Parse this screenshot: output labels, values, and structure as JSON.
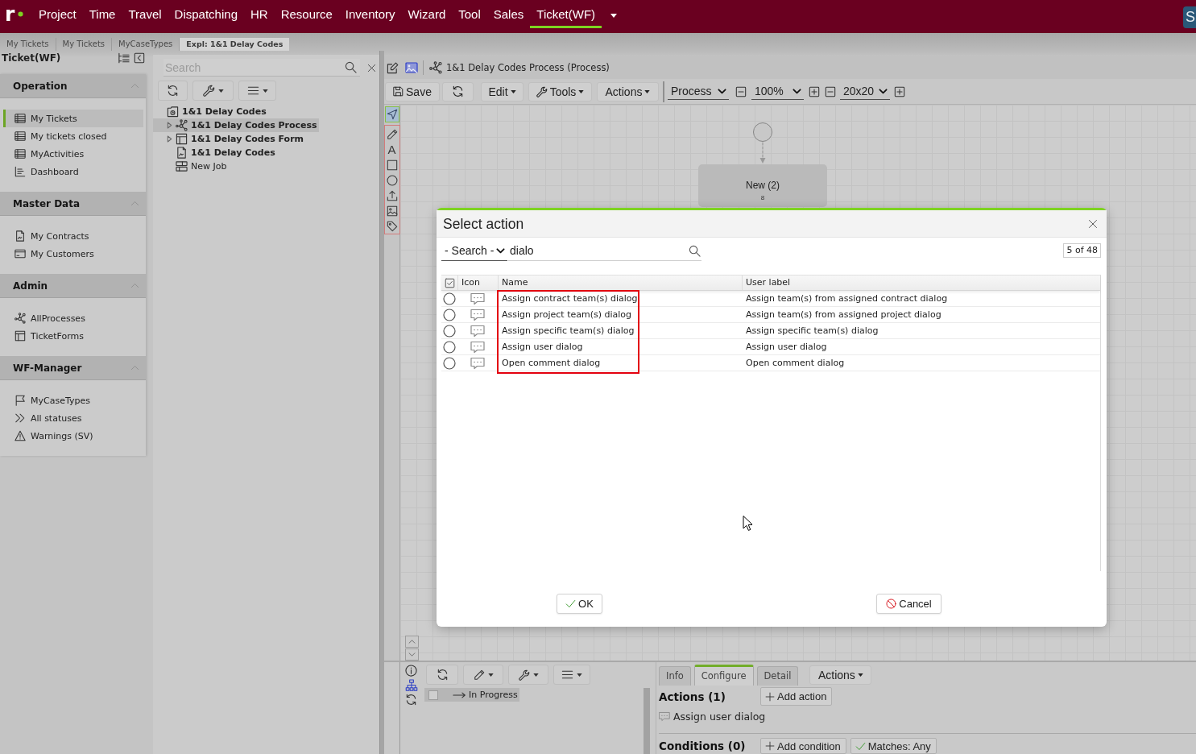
{
  "nav": {
    "logo": "r",
    "menu": [
      {
        "label": "Project",
        "selected": false
      },
      {
        "label": "Time",
        "selected": false
      },
      {
        "label": "Travel",
        "selected": false
      },
      {
        "label": "Dispatching",
        "selected": false
      },
      {
        "label": "HR",
        "selected": false
      },
      {
        "label": "Resource",
        "selected": false
      },
      {
        "label": "Inventory",
        "selected": false
      },
      {
        "label": "Wizard",
        "selected": false
      },
      {
        "label": "Tool",
        "selected": false
      },
      {
        "label": "Sales",
        "selected": false
      },
      {
        "label": "Ticket(WF)",
        "selected": true
      }
    ],
    "user": "S"
  },
  "breadcrumbs": [
    {
      "label": "My Tickets",
      "selected": false
    },
    {
      "label": "My Tickets",
      "selected": false
    },
    {
      "label": "MyCaseTypes",
      "selected": false
    },
    {
      "label": "Expl: 1&1 Delay Codes",
      "selected": true
    }
  ],
  "sidebar": {
    "title": "Ticket(WF)",
    "sections": [
      {
        "title": "Operation",
        "expanded": true,
        "items": [
          {
            "label": "My Tickets",
            "kind": "table",
            "selected": true
          },
          {
            "label": "My tickets closed",
            "kind": "table",
            "selected": false
          },
          {
            "label": "MyActivities",
            "kind": "table",
            "selected": false
          },
          {
            "label": "Dashboard",
            "kind": "dashboard",
            "selected": false
          }
        ]
      },
      {
        "title": "Master Data",
        "expanded": true,
        "items": [
          {
            "label": "My Contracts",
            "kind": "document",
            "selected": false
          },
          {
            "label": "My Customers",
            "kind": "card",
            "selected": false
          }
        ]
      },
      {
        "title": "Admin",
        "expanded": true,
        "items": [
          {
            "label": "AllProcesses",
            "kind": "process",
            "selected": false
          },
          {
            "label": "TicketForms",
            "kind": "form",
            "selected": false
          }
        ]
      },
      {
        "title": "WF-Manager",
        "expanded": true,
        "items": [
          {
            "label": "MyCaseTypes",
            "kind": "flag",
            "selected": false
          },
          {
            "label": "All statuses",
            "kind": "chevrons",
            "selected": false
          },
          {
            "label": "Warnings (SV)",
            "kind": "warning",
            "selected": false
          }
        ]
      }
    ]
  },
  "explorer": {
    "search": {
      "placeholder": "Search"
    },
    "tree": [
      {
        "label": "1&1 Delay Codes",
        "kind": "folder",
        "bold": true,
        "selected": false,
        "collapsed": false,
        "children": [
          {
            "label": "1&1 Delay Codes Process",
            "kind": "process",
            "bold": true,
            "selected": true,
            "collapsed": true
          },
          {
            "label": "1&1 Delay Codes Form",
            "kind": "form",
            "bold": true,
            "selected": false,
            "collapsed": true
          },
          {
            "label": "1&1 Delay Codes",
            "kind": "document",
            "bold": true,
            "selected": false,
            "collapsed": false
          },
          {
            "label": "New Job",
            "kind": "job",
            "bold": false,
            "selected": false,
            "collapsed": false
          }
        ]
      }
    ]
  },
  "editor": {
    "title": "1&1 Delay Codes Process (Process)",
    "toolbar": {
      "save": "Save",
      "edit": "Edit",
      "tools": "Tools",
      "actions": "Actions",
      "mode": "Process",
      "zoom": "100%",
      "grid": "20x20"
    },
    "palette": [
      {
        "kind": "pointer",
        "selected": true
      },
      {
        "kind": "pencil",
        "selected": false
      },
      {
        "kind": "text",
        "glyph": "A",
        "selected": false
      },
      {
        "kind": "rectangle",
        "selected": false
      },
      {
        "kind": "ellipse",
        "selected": false
      },
      {
        "kind": "upload",
        "selected": false
      },
      {
        "kind": "image",
        "selected": false
      },
      {
        "kind": "tag",
        "selected": false
      }
    ],
    "canvas": {
      "nodes": [
        {
          "kind": "start"
        },
        {
          "kind": "status",
          "label": "New (2)",
          "badge": "8"
        }
      ]
    }
  },
  "details": {
    "list": [
      {
        "label": "In Progress",
        "checked": false,
        "selected": true
      }
    ],
    "tabs": [
      {
        "label": "Info",
        "selected": false
      },
      {
        "label": "Configure",
        "selected": true
      },
      {
        "label": "Detail",
        "selected": false
      }
    ],
    "menu": "Actions",
    "actions": {
      "title": "Actions (1)",
      "add": "Add action",
      "items": [
        {
          "label": "Assign user dialog"
        }
      ]
    },
    "conditions": {
      "title": "Conditions (0)",
      "add": "Add condition",
      "match": "Matches: Any"
    }
  },
  "dialog": {
    "title": "Select action",
    "search": {
      "field": "- Search -",
      "value": "dialo"
    },
    "count": "5 of 48",
    "columns": [
      "Icon",
      "Name",
      "User label"
    ],
    "rows": [
      {
        "name": "Assign contract team(s) dialog",
        "user_label": "Assign team(s) from assigned contract dialog",
        "selected": false
      },
      {
        "name": "Assign project team(s) dialog",
        "user_label": "Assign team(s) from assigned project dialog",
        "selected": false
      },
      {
        "name": "Assign specific team(s) dialog",
        "user_label": "Assign specific team(s) dialog",
        "selected": false
      },
      {
        "name": "Assign user dialog",
        "user_label": "Assign user dialog",
        "selected": false
      },
      {
        "name": "Open comment dialog",
        "user_label": "Open comment dialog",
        "selected": false
      }
    ],
    "buttons": {
      "ok": "OK",
      "cancel": "Cancel"
    }
  }
}
